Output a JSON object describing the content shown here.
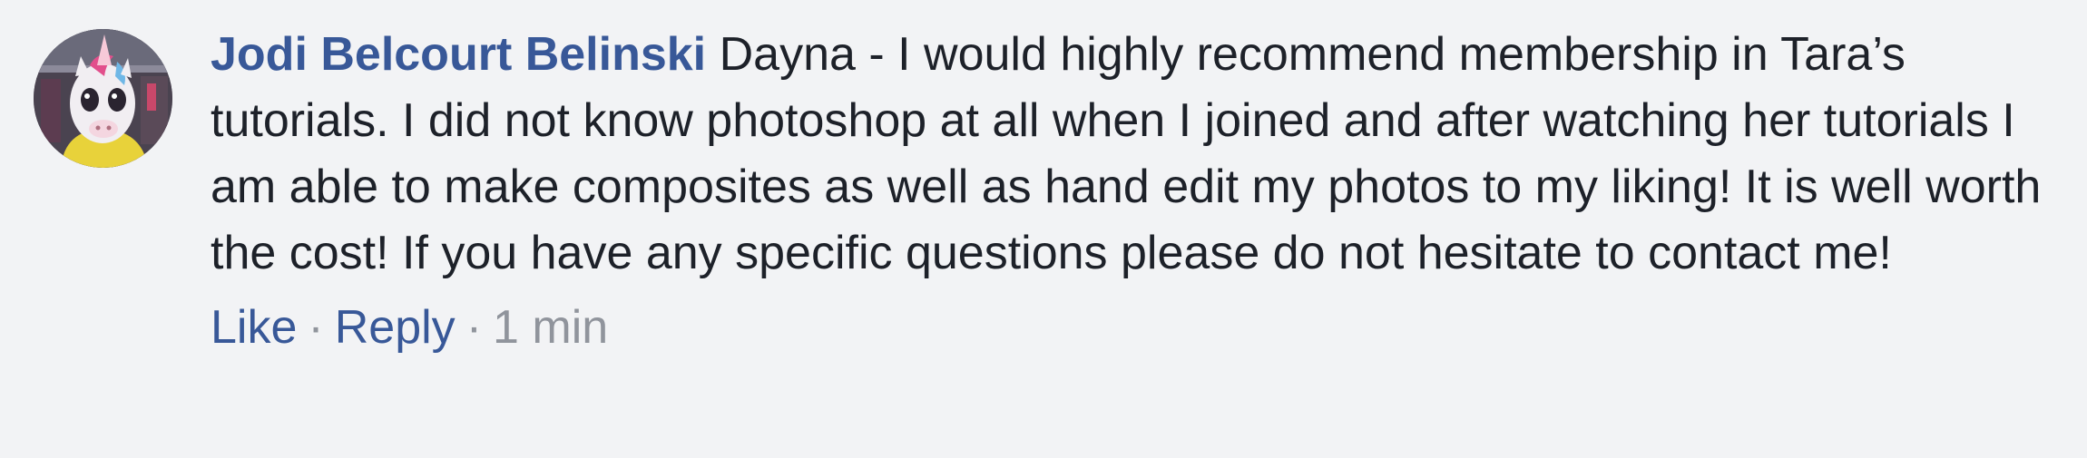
{
  "comment": {
    "author": "Jodi Belcourt Belinski",
    "text": "Dayna - I would highly recommend membership in Tara’s tutorials. I did not know photoshop at all when I joined and after watching her tutorials I am able to make composites as well as hand edit my photos to my liking! It is well worth the cost! If you have any specific questions please do not hesitate to contact me!",
    "actions": {
      "like_label": "Like",
      "reply_label": "Reply",
      "separator": "·",
      "timestamp": "1 min"
    }
  },
  "colors": {
    "background": "#f2f3f5",
    "author_link": "#385898",
    "body_text": "#1d2129",
    "meta_text": "#90949c"
  }
}
